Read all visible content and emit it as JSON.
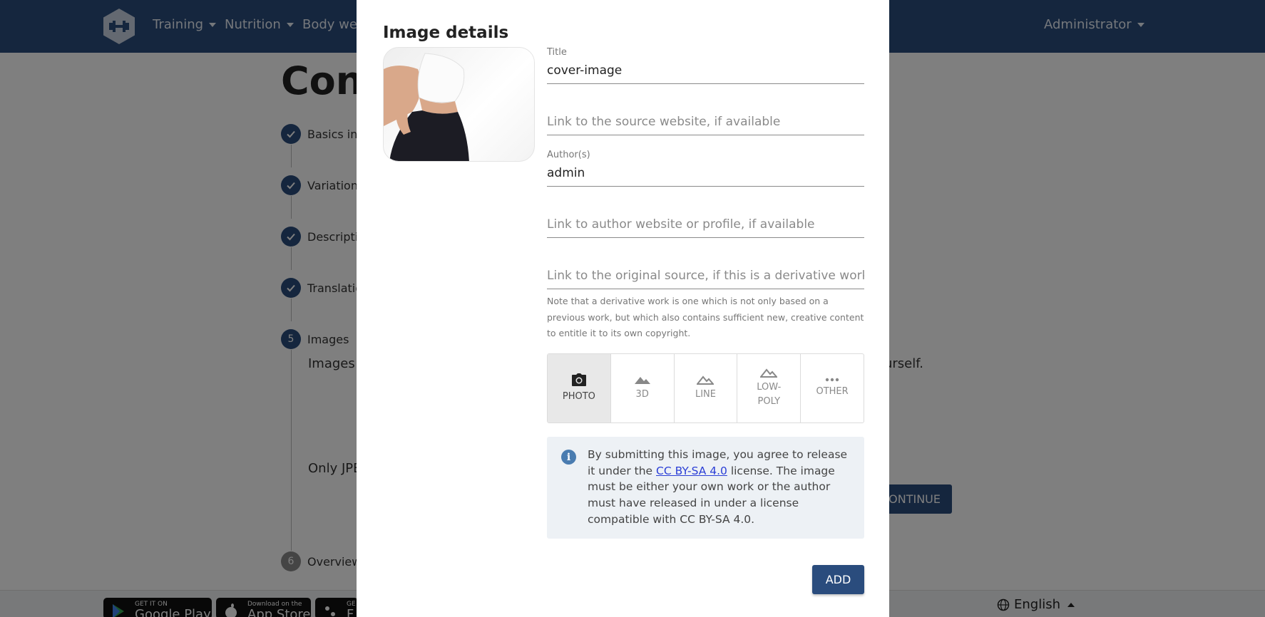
{
  "navbar": {
    "items": [
      "Training",
      "Nutrition",
      "Body weig"
    ],
    "user": "Administrator"
  },
  "page": {
    "title": "Cont",
    "steps": [
      {
        "number": "",
        "label": "Basics in E",
        "done": true
      },
      {
        "number": "",
        "label": "Variations",
        "done": true
      },
      {
        "number": "",
        "label": "Descriptio",
        "done": true
      },
      {
        "number": "",
        "label": "Translatio",
        "done": true
      },
      {
        "number": "5",
        "label": "Images",
        "done": false
      },
      {
        "number": "6",
        "label": "Overview",
        "done": false
      }
    ],
    "images_text_left": "Images m",
    "images_text_right": "urself.",
    "only_text": "Only JPEG",
    "continue_label": "CONTINUE"
  },
  "footer": {
    "google_small": "GET IT ON",
    "google_big": "Google Play",
    "apple_small": "Download on the",
    "apple_big": "App Store",
    "third_small": "GE",
    "third_big": "F",
    "language": "English"
  },
  "modal": {
    "title": "Image details",
    "fields": {
      "title": {
        "label": "Title",
        "value": "cover-image"
      },
      "source_link": {
        "placeholder": "Link to the source website, if available"
      },
      "authors": {
        "label": "Author(s)",
        "value": "admin"
      },
      "author_link": {
        "placeholder": "Link to author website or profile, if available"
      },
      "derivative_link": {
        "placeholder": "Link to the original source, if this is a derivative work"
      }
    },
    "note": "Note that a derivative work is one which is not only based on a previous work, but which also contains sufficient new, creative content to entitle it to its own copyright.",
    "styles": [
      {
        "label": "PHOTO",
        "icon": "camera-icon",
        "active": true
      },
      {
        "label": "3D",
        "icon": "mountain-icon",
        "active": false
      },
      {
        "label": "LINE",
        "icon": "mountain-outline-icon",
        "active": false
      },
      {
        "label": "LOW-\nPOLY",
        "icon": "mountain-outline-icon",
        "active": false
      },
      {
        "label": "OTHER",
        "icon": "more-dots-icon",
        "active": false
      }
    ],
    "license": {
      "before": "By submitting this image, you agree to release it under the ",
      "link": "CC BY-SA 4.0",
      "after": " license. The image must be either your own work or the author must have released in under a license compatible with CC BY-SA 4.0."
    },
    "add_label": "ADD"
  }
}
